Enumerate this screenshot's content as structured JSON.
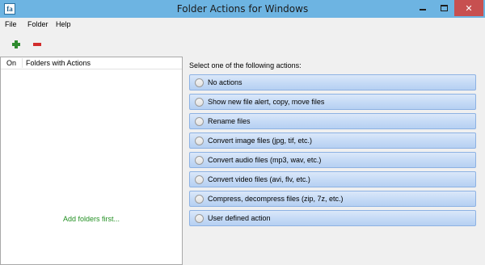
{
  "window": {
    "title": "Folder Actions for Windows",
    "icon_text": "fa"
  },
  "menu": [
    "File",
    "Folder",
    "Help"
  ],
  "toolbar": {
    "add_icon": "plus-icon",
    "remove_icon": "minus-icon",
    "add_color": "#2e8b2e",
    "remove_color": "#d22c2c"
  },
  "folders_list": {
    "columns": [
      "On",
      "Folders with Actions"
    ],
    "empty_hint": "Add folders first..."
  },
  "actions": {
    "prompt": "Select one of the following actions:",
    "options": [
      "No actions",
      "Show new file alert, copy, move files",
      "Rename files",
      "Convert image files (jpg, tif, etc.)",
      "Convert audio files (mp3, wav, etc.)",
      "Convert video files (avi, flv, etc.)",
      "Compress, decompress files (zip, 7z, etc.)",
      "User defined action"
    ]
  },
  "colors": {
    "titlebar": "#6db4e2",
    "close_button": "#c75050",
    "hint_text": "#239023",
    "action_button_border": "#8db2e3"
  }
}
